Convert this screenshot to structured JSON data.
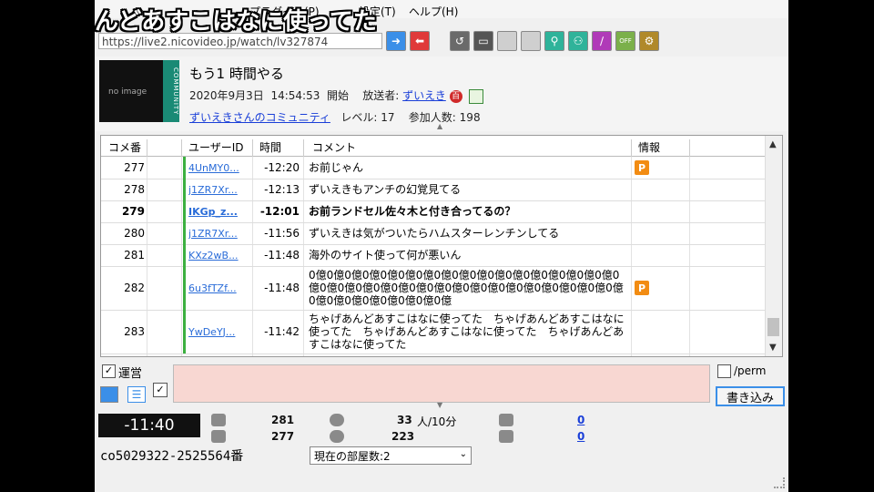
{
  "overlay_text": "んどあすこはなに使ってた",
  "menu": {
    "items": [
      "プラグイン(P)",
      "設定(T)",
      "ヘルプ(H)"
    ]
  },
  "toolbar": {
    "url": "https://live2.nicovideo.jp/watch/lv327874"
  },
  "program": {
    "thumbnail_text": "no image",
    "thumbnail_badge": "COMMUNITY",
    "title": "もう1 時間やる",
    "date": "2020年9月3日",
    "start_time": "14:54:53",
    "start_label": "開始",
    "broadcaster_label": "放送者:",
    "broadcaster": "ずいえき",
    "community": "ずいえきさんのコミュニティ",
    "level_label": "レベル:",
    "level": "17",
    "viewers_label": "参加人数:",
    "viewers": "198"
  },
  "grid": {
    "columns": [
      "コメ番",
      "ユーザーID",
      "時間",
      "コメント",
      "情報"
    ],
    "rows": [
      {
        "num": "277",
        "uid": "4UnMY0...",
        "time": "-12:20",
        "comment": "お前じゃん",
        "info": "P",
        "bold": false
      },
      {
        "num": "278",
        "uid": "j1ZR7Xr...",
        "time": "-12:13",
        "comment": "ずいえきもアンチの幻覚見てる",
        "info": "",
        "bold": false
      },
      {
        "num": "279",
        "uid": "IKGp_z...",
        "time": "-12:01",
        "comment": "お前ランドセル佐々木と付き合ってるの？",
        "info": "",
        "bold": true
      },
      {
        "num": "280",
        "uid": "j1ZR7Xr...",
        "time": "-11:56",
        "comment": "ずいえきは気がついたらハムスターレンチンしてる",
        "info": "",
        "bold": false
      },
      {
        "num": "281",
        "uid": "KXz2wB...",
        "time": "-11:48",
        "comment": "海外のサイト使って何が悪いん",
        "info": "",
        "bold": false
      },
      {
        "num": "282",
        "uid": "6u3fTZf...",
        "time": "-11:48",
        "comment": "0億0億0億0億0億0億0億0億0億0億0億0億0億0億0億0億0億0億0億0億0億0億0億0億0億0億0億0億0億0億0億0億0億0億0億0億0億0億0億0億0億0億0億",
        "info": "P",
        "bold": false
      },
      {
        "num": "283",
        "uid": "YwDeYJ...",
        "time": "-11:42",
        "comment": "ちゃげあんどあすこはなに使ってた　ちゃげあんどあすこはなに使ってた　ちゃげあんどあすこはなに使ってた　ちゃげあんどあすこはなに使ってた",
        "info": "",
        "bold": false
      }
    ]
  },
  "post": {
    "operator_label": "運営",
    "perm_label": "/perm",
    "submit_label": "書き込み"
  },
  "status": {
    "elapsed": "-11:40",
    "comments_a": "281",
    "comments_b": "277",
    "visitors": "33",
    "visitors_unit": "人/10分",
    "visitors_b": "223",
    "ad_a": "0",
    "ad_b": "0",
    "live_id": "co5029322-2525564番",
    "room_count": "現在の部屋数:2"
  },
  "colors": {
    "comment_box": "#f8d7d2",
    "premium_badge": "#f28c13",
    "link": "#1a3fd8",
    "thumb_badge": "#1a8a75"
  }
}
